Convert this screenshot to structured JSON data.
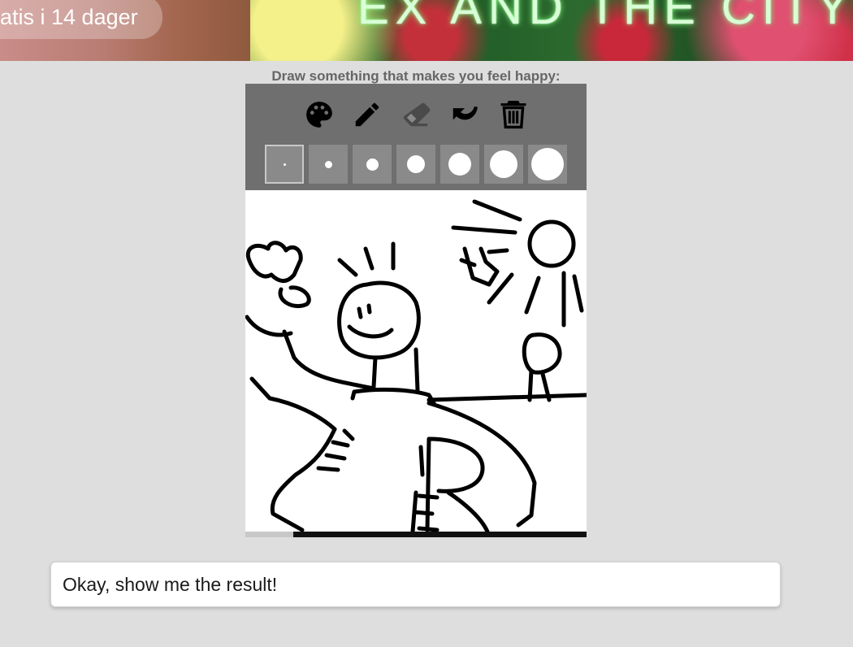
{
  "banner": {
    "trial_text": "atis i 14 dager",
    "title_fragment": "EX AND THE CITY"
  },
  "drawing": {
    "prompt": "Draw something that makes you feel happy:",
    "tools": [
      {
        "name": "palette-icon",
        "label": "palette"
      },
      {
        "name": "pencil-icon",
        "label": "pencil"
      },
      {
        "name": "eraser-icon",
        "label": "eraser"
      },
      {
        "name": "undo-icon",
        "label": "undo"
      },
      {
        "name": "trash-icon",
        "label": "trash"
      }
    ],
    "brush_sizes_count": 7,
    "selected_brush_index": 0,
    "progress_fraction": 0.14,
    "colors": {
      "toolbar": "#6f6f6f",
      "size_button": "#8a8a8a",
      "canvas": "#ffffff",
      "ink": "#000000",
      "progress": "#111111"
    }
  },
  "submit": {
    "label": "Okay, show me the result!"
  }
}
